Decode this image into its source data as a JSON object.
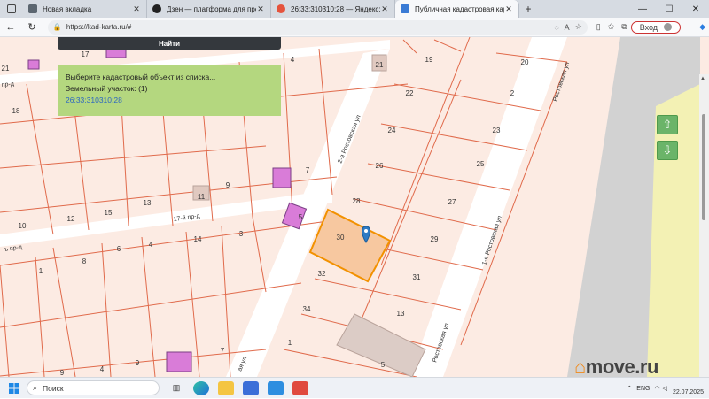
{
  "tabs": [
    {
      "title": "Новая вкладка",
      "color": "#5c6670",
      "active": false
    },
    {
      "title": "Дзен — платформа для просмо",
      "color": "#222222",
      "active": false
    },
    {
      "title": "26:33:310310:28 — Яндекс: наш",
      "color": "#e5533d",
      "active": false
    },
    {
      "title": "Публичная кадастровая карта Р",
      "color": "#3a7bd5",
      "active": true
    }
  ],
  "address": {
    "url": "https://kad-karta.ru/#"
  },
  "toolbar": {
    "login_label": "Вход"
  },
  "panel": {
    "find_label": "Найти",
    "prompt": "Выберите кадастровый объект из списка...",
    "land_label": "Земельный участок: (1)",
    "cadastral_link": "26:33:310310:28"
  },
  "map": {
    "street_labels": [
      "17-й пр-д",
      "2-я Ростовская ул",
      "1-я Ростовская ул",
      "пр-д",
      "Ростовская ул",
      "Ростовская ул",
      "ая ул"
    ],
    "plot_numbers": [
      "17",
      "21",
      "18",
      "19",
      "20",
      "2",
      "22",
      "21",
      "24",
      "23",
      "26",
      "25",
      "28",
      "27",
      "30",
      "29",
      "32",
      "31",
      "34",
      "13",
      "1",
      "5",
      "7",
      "9",
      "11",
      "13",
      "15",
      "12",
      "10",
      "8",
      "6",
      "4",
      "14",
      "3",
      "1",
      "5",
      "7",
      "9",
      "4"
    ],
    "selected_plot": "28"
  },
  "watermark": {
    "text": "move.ru"
  },
  "taskbar": {
    "search_placeholder": "Поиск",
    "lang": "ENG",
    "date": "22.07.2025"
  }
}
